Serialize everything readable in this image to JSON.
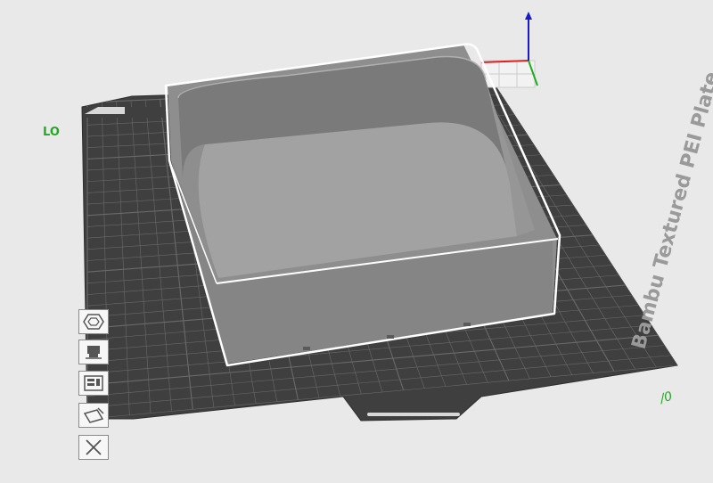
{
  "viewport": {
    "plate_label": "Bambu Textured PEI Plate",
    "origin_label": "LO",
    "corner_label": "/0",
    "colors": {
      "background": "#e9e9e9",
      "plate": "#3f3f3f",
      "grid": "#6a6a6a",
      "model_wall": "#8e8e8e",
      "model_inner": "#a2a2a2",
      "selection": "#ffffff",
      "axis_x": "#e02020",
      "axis_y": "#22aa22",
      "axis_z": "#1a1acc"
    }
  },
  "plate_toolbar": {
    "items": [
      {
        "name": "arrange",
        "icon": "hexagon-icon"
      },
      {
        "name": "bed-type",
        "icon": "printer-head-icon"
      },
      {
        "name": "plate-settings",
        "icon": "settings-panel-icon"
      },
      {
        "name": "edit-plate",
        "icon": "edit-plate-icon"
      },
      {
        "name": "delete-plate",
        "icon": "close-icon"
      }
    ]
  }
}
